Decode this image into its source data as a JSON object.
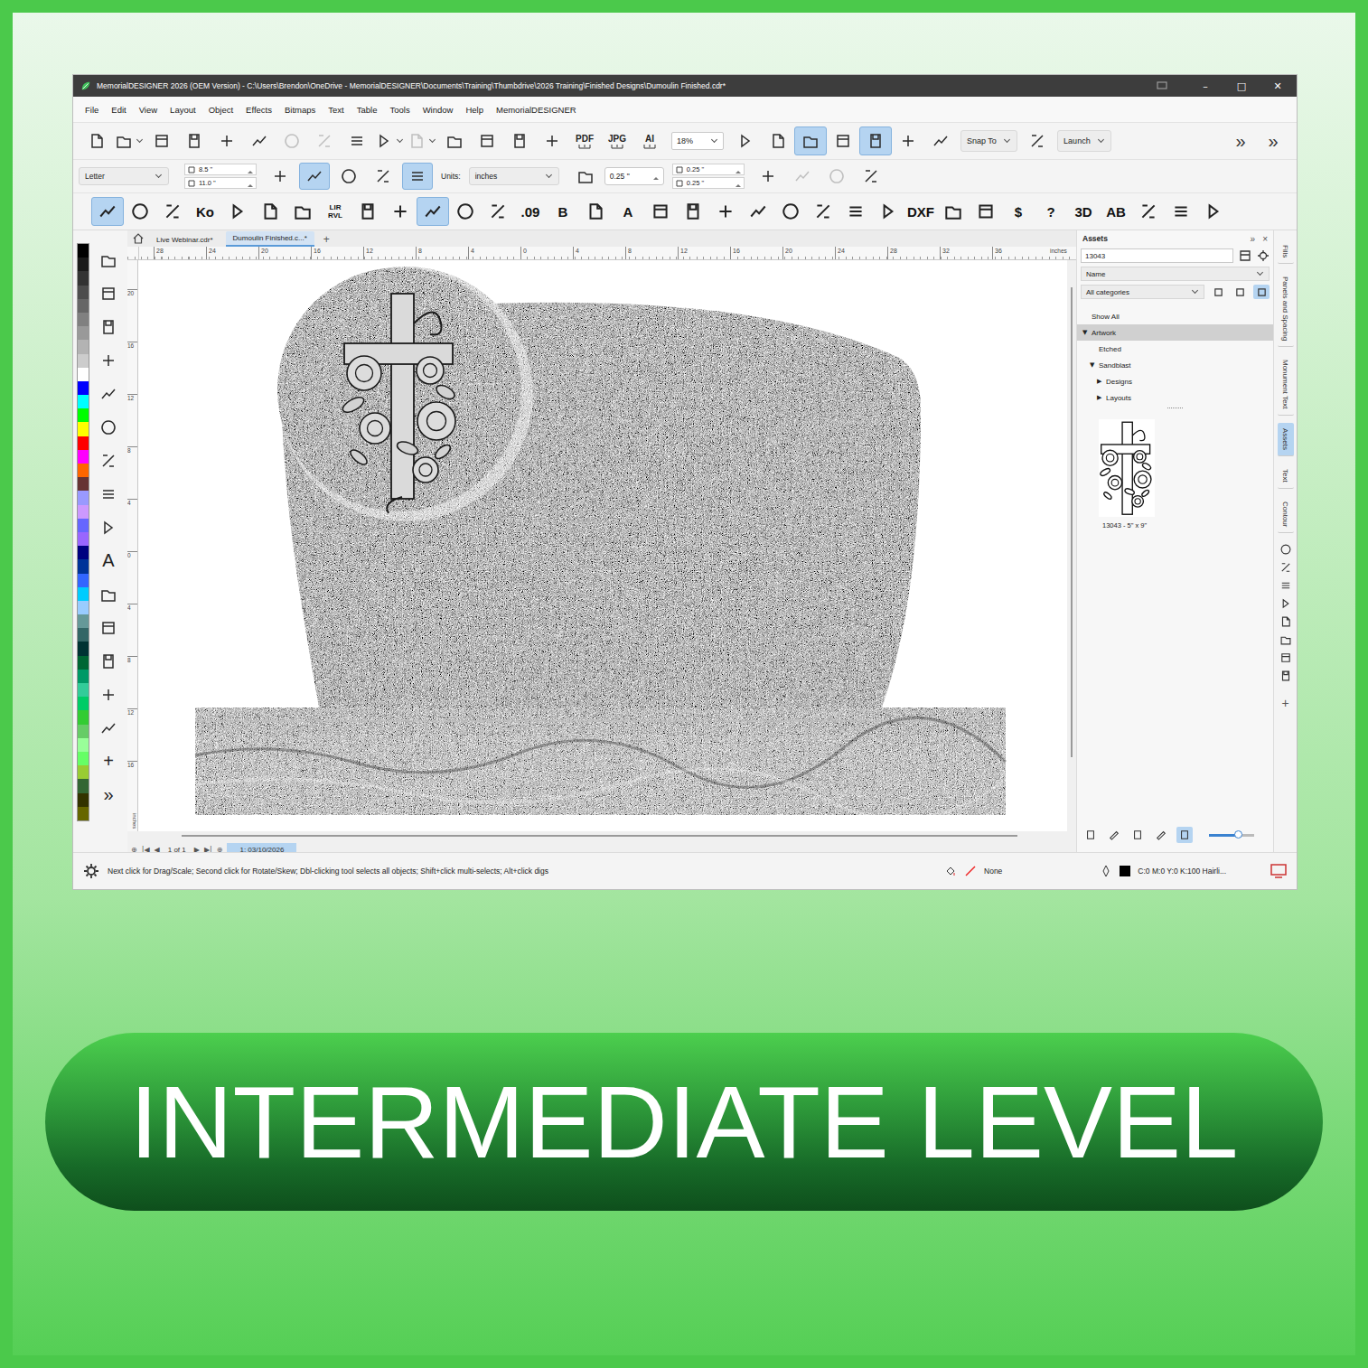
{
  "window": {
    "title": "MemorialDESIGNER 2026 (OEM Version) - C:\\Users\\Brendon\\OneDrive - MemorialDESIGNER\\Documents\\Training\\Thumbdrive\\2026 Training\\Finished Designs\\Dumoulin Finished.cdr*",
    "controls": [
      "–",
      "□",
      "✕"
    ]
  },
  "menu": [
    "File",
    "Edit",
    "View",
    "Layout",
    "Object",
    "Effects",
    "Bitmaps",
    "Text",
    "Table",
    "Tools",
    "Window",
    "Help",
    "MemorialDESIGNER"
  ],
  "toolbar": [
    {
      "kind": "icon",
      "selected": false,
      "disabled": false,
      "menu": false
    },
    {
      "kind": "icon",
      "selected": false,
      "disabled": false,
      "menu": true
    },
    {
      "kind": "icon",
      "selected": false,
      "disabled": false,
      "menu": false
    },
    {
      "kind": "icon",
      "selected": false,
      "disabled": false,
      "menu": false
    },
    {
      "kind": "icon",
      "selected": false,
      "disabled": false,
      "menu": false
    },
    {
      "kind": "icon",
      "selected": false,
      "disabled": false,
      "menu": false
    },
    {
      "kind": "icon",
      "selected": false,
      "disabled": true,
      "menu": false
    },
    {
      "kind": "icon",
      "selected": false,
      "disabled": true,
      "menu": false
    },
    {
      "kind": "icon",
      "selected": false,
      "disabled": false,
      "menu": false
    },
    {
      "kind": "icon",
      "selected": false,
      "disabled": false,
      "menu": true
    },
    {
      "kind": "icon",
      "selected": false,
      "disabled": true,
      "menu": true
    },
    {
      "kind": "icon",
      "selected": false,
      "disabled": false,
      "menu": false
    },
    {
      "kind": "icon",
      "selected": false,
      "disabled": false,
      "menu": false
    },
    {
      "kind": "icon",
      "selected": false,
      "disabled": false,
      "menu": false
    },
    {
      "kind": "icon",
      "selected": false,
      "disabled": false,
      "menu": false
    },
    {
      "kind": "text",
      "label": "PDF",
      "selected": false,
      "disabled": false,
      "menu": false
    },
    {
      "kind": "text",
      "label": "JPG",
      "selected": false,
      "disabled": false,
      "menu": false
    },
    {
      "kind": "text",
      "label": "AI",
      "selected": false,
      "disabled": false,
      "menu": false
    },
    {
      "kind": "field",
      "label": "18%",
      "selected": false,
      "disabled": false,
      "menu": true
    },
    {
      "kind": "icon",
      "selected": false,
      "disabled": false,
      "menu": false
    },
    {
      "kind": "icon",
      "selected": false,
      "disabled": false,
      "menu": false
    },
    {
      "kind": "icon",
      "selected": true,
      "disabled": false,
      "menu": false
    },
    {
      "kind": "icon",
      "selected": false,
      "disabled": false,
      "menu": false
    },
    {
      "kind": "icon",
      "selected": true,
      "disabled": false,
      "menu": false
    },
    {
      "kind": "icon",
      "selected": false,
      "disabled": false,
      "menu": false
    },
    {
      "kind": "icon",
      "selected": false,
      "disabled": false,
      "menu": false
    },
    {
      "kind": "dropdown",
      "label": "Snap To",
      "selected": false,
      "disabled": false,
      "menu": true
    },
    {
      "kind": "icon",
      "selected": false,
      "disabled": false,
      "menu": false
    },
    {
      "kind": "dropdown",
      "label": "Launch",
      "selected": false,
      "disabled": false,
      "menu": true
    }
  ],
  "toolbar_end": [
    "»",
    "»"
  ],
  "property_bar": [
    {
      "kind": "dropdown",
      "label": "Letter",
      "selected": false,
      "disabled": false
    },
    {
      "kind": "stack",
      "values": [
        "8.5 \"",
        "11.0 \""
      ],
      "selected": false,
      "disabled": false
    },
    {
      "kind": "icon",
      "selected": false,
      "disabled": false
    },
    {
      "kind": "icon",
      "selected": true,
      "disabled": false
    },
    {
      "kind": "icon",
      "selected": false,
      "disabled": false
    },
    {
      "kind": "icon",
      "selected": false,
      "disabled": false
    },
    {
      "kind": "icon",
      "selected": true,
      "disabled": false
    },
    {
      "kind": "label",
      "label": "Units:",
      "selected": false,
      "disabled": false
    },
    {
      "kind": "dropdown",
      "label": "inches",
      "selected": false,
      "disabled": false
    },
    {
      "kind": "icon",
      "selected": false,
      "disabled": false
    },
    {
      "kind": "field",
      "label": "0.25 \"",
      "selected": false,
      "disabled": false
    },
    {
      "kind": "stack",
      "values": [
        "0.25 \"",
        "0.25 \""
      ],
      "selected": false,
      "disabled": false
    },
    {
      "kind": "icon",
      "selected": false,
      "disabled": false
    },
    {
      "kind": "icon",
      "selected": false,
      "disabled": true
    },
    {
      "kind": "icon",
      "selected": false,
      "disabled": true
    },
    {
      "kind": "icon",
      "selected": false,
      "disabled": false
    }
  ],
  "tool_row": [
    {
      "kind": "icon",
      "selected": true
    },
    {
      "kind": "icon",
      "selected": false
    },
    {
      "kind": "icon",
      "selected": false
    },
    {
      "kind": "text",
      "label": "Ko",
      "selected": false
    },
    {
      "kind": "icon",
      "selected": false
    },
    {
      "kind": "icon",
      "selected": false
    },
    {
      "kind": "icon",
      "selected": false
    },
    {
      "kind": "stack",
      "lines": [
        "LIR",
        "RVL"
      ],
      "selected": false
    },
    {
      "kind": "icon",
      "selected": false
    },
    {
      "kind": "icon",
      "selected": false
    },
    {
      "kind": "icon",
      "selected": true
    },
    {
      "kind": "icon",
      "selected": false
    },
    {
      "kind": "icon",
      "selected": false
    },
    {
      "kind": "text",
      "label": ".09",
      "selected": false
    },
    {
      "kind": "text",
      "label": "B",
      "selected": false
    },
    {
      "kind": "icon",
      "selected": false
    },
    {
      "kind": "text",
      "label": "A",
      "selected": false
    },
    {
      "kind": "icon",
      "selected": false
    },
    {
      "kind": "icon",
      "selected": false
    },
    {
      "kind": "icon",
      "selected": false
    },
    {
      "kind": "icon",
      "selected": false
    },
    {
      "kind": "icon",
      "selected": false
    },
    {
      "kind": "icon",
      "selected": false
    },
    {
      "kind": "icon",
      "selected": false
    },
    {
      "kind": "icon",
      "selected": false
    },
    {
      "kind": "text",
      "label": "DXF",
      "selected": false
    },
    {
      "kind": "icon",
      "selected": false
    },
    {
      "kind": "icon",
      "selected": false
    },
    {
      "kind": "text",
      "label": "$",
      "selected": false
    },
    {
      "kind": "text",
      "label": "?",
      "selected": false
    },
    {
      "kind": "text",
      "label": "3D",
      "selected": false
    },
    {
      "kind": "text",
      "label": "AB",
      "selected": false
    },
    {
      "kind": "icon",
      "selected": false
    },
    {
      "kind": "icon",
      "selected": false
    },
    {
      "kind": "icon",
      "selected": false
    }
  ],
  "palette": [
    "#000000",
    "#1a1a1a",
    "#333333",
    "#4d4d4d",
    "#666666",
    "#808080",
    "#999999",
    "#b3b3b3",
    "#cccccc",
    "#ffffff",
    "#0000ff",
    "#00ffff",
    "#00ff00",
    "#ffff00",
    "#ff0000",
    "#ff00ff",
    "#ff6600",
    "#663333",
    "#9999ff",
    "#cc99ff",
    "#6666ff",
    "#9966ff",
    "#000080",
    "#003399",
    "#3366ff",
    "#00ccff",
    "#99ccff",
    "#669999",
    "#336666",
    "#003333",
    "#006633",
    "#009966",
    "#33cc99",
    "#00cc66",
    "#33cc33",
    "#66cc66",
    "#99ff99",
    "#66ff66",
    "#99cc33",
    "#336633",
    "#333300",
    "#666600"
  ],
  "toolbox": [
    {
      "kind": "icon",
      "selected": false
    },
    {
      "kind": "icon",
      "selected": false
    },
    {
      "kind": "icon",
      "selected": false
    },
    {
      "kind": "icon",
      "selected": false
    },
    {
      "kind": "icon",
      "selected": false
    },
    {
      "kind": "icon",
      "selected": false
    },
    {
      "kind": "icon",
      "selected": false
    },
    {
      "kind": "icon",
      "selected": false
    },
    {
      "kind": "icon",
      "selected": false
    },
    {
      "kind": "text",
      "label": "A",
      "selected": false
    },
    {
      "kind": "icon",
      "selected": false
    },
    {
      "kind": "icon",
      "selected": false
    },
    {
      "kind": "icon",
      "selected": false
    },
    {
      "kind": "icon",
      "selected": false
    },
    {
      "kind": "icon",
      "selected": false
    },
    {
      "kind": "text",
      "label": "+",
      "selected": false
    },
    {
      "kind": "text",
      "label": "»",
      "selected": false
    }
  ],
  "doc_tabs": [
    {
      "label": "Live Webinar.cdr*",
      "selected": false
    },
    {
      "label": "Dumoulin Finished.c...*",
      "selected": true
    }
  ],
  "doc_tab_add": "+",
  "ruler_h": [
    "28",
    "24",
    "20",
    "16",
    "12",
    "8",
    "4",
    "0",
    "4",
    "8",
    "12",
    "16",
    "20",
    "24",
    "28",
    "32",
    "36"
  ],
  "ruler_h_unit": "inches",
  "ruler_v": [
    "20",
    "16",
    "12",
    "8",
    "4",
    "0",
    "4",
    "8",
    "12",
    "16"
  ],
  "ruler_v_unit": "inches",
  "assets": {
    "title": "Assets",
    "header_buttons": [
      "»",
      "×"
    ],
    "search": "13043",
    "sort": "Name",
    "category": "All categories",
    "view_buttons": [
      {
        "selected": false
      },
      {
        "selected": false
      },
      {
        "selected": true
      }
    ],
    "tree": [
      {
        "label": "Show All",
        "depth": 0,
        "selected": false
      },
      {
        "toggle": "▼",
        "label": "Artwork",
        "depth": 0,
        "selected": true
      },
      {
        "label": "Etched",
        "depth": 1,
        "selected": false
      },
      {
        "toggle": "▼",
        "label": "Sandblast",
        "depth": 1,
        "selected": false
      },
      {
        "toggle": "▶",
        "label": "Designs",
        "depth": 2,
        "selected": false
      },
      {
        "toggle": "▶",
        "label": "Layouts",
        "depth": 2,
        "selected": false
      }
    ],
    "thumbnail_caption": "13043 - 5\" x 9\"",
    "footer_icons": [
      {
        "selected": false
      },
      {
        "selected": false
      },
      {
        "selected": false
      },
      {
        "selected": false
      },
      {
        "selected": true
      }
    ],
    "zoom": {
      "level": 0.65
    }
  },
  "docker_tabs": [
    {
      "kind": "tab",
      "label": "Fills",
      "selected": false
    },
    {
      "kind": "tab",
      "label": "Panels and Spacing",
      "selected": false
    },
    {
      "kind": "tab",
      "label": "Monument Text",
      "selected": false
    },
    {
      "kind": "tab",
      "label": "Assets",
      "selected": true
    },
    {
      "kind": "tab",
      "label": "Text",
      "selected": false
    },
    {
      "kind": "tab",
      "label": "Contour",
      "selected": false
    },
    {
      "kind": "icon",
      "selected": false
    },
    {
      "kind": "icon",
      "selected": false
    },
    {
      "kind": "icon",
      "selected": false
    },
    {
      "kind": "icon",
      "selected": false
    },
    {
      "kind": "icon",
      "selected": false
    },
    {
      "kind": "icon",
      "selected": false
    },
    {
      "kind": "icon",
      "selected": false
    },
    {
      "kind": "icon",
      "selected": false
    },
    {
      "kind": "text",
      "label": "+",
      "selected": false
    }
  ],
  "page_nav": {
    "buttons_left": [
      "⊕",
      "|◀",
      "◀"
    ],
    "count": "1 of 1",
    "buttons_right": [
      "▶",
      "▶|",
      "⊕"
    ],
    "pages": [
      {
        "label": "1: 03/10/2026",
        "selected": true
      }
    ]
  },
  "status_bar": {
    "hint": "Next click for Drag/Scale; Second click for Rotate/Skew; Dbl-clicking tool selects all objects; Shift+click multi-selects; Alt+click digs",
    "fill": "None",
    "outline": "C:0 M:0 Y:0 K:100 Hairli..."
  },
  "banner": "INTERMEDIATE LEVEL"
}
